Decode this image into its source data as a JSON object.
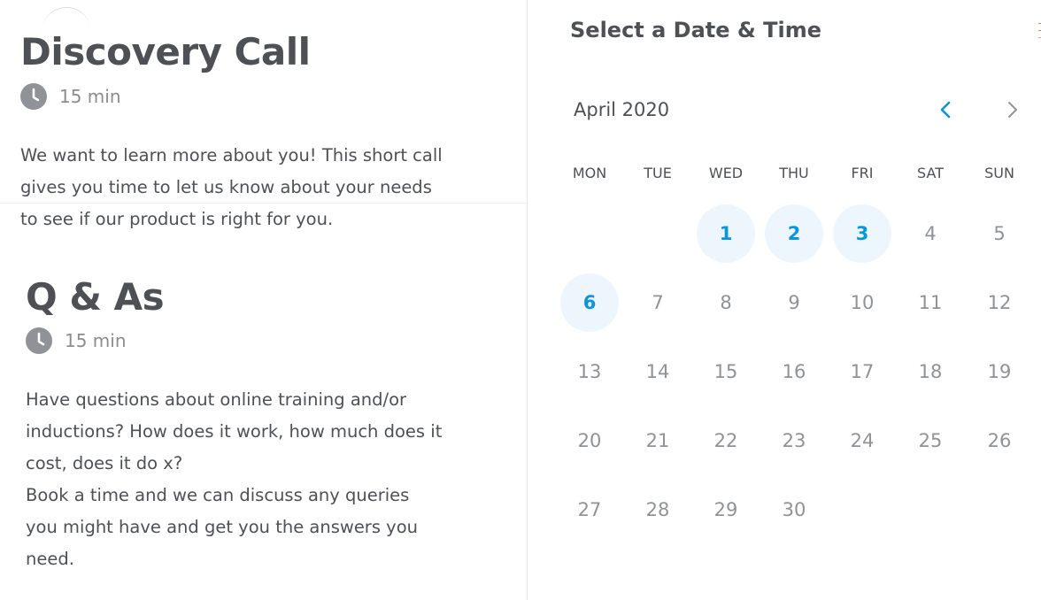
{
  "events": [
    {
      "title": "Discovery Call",
      "duration": "15 min",
      "description_lines": [
        "We want to learn more about you! This short call",
        "gives you time to let us know about your needs",
        "to see if our product is right for you."
      ]
    },
    {
      "title": "Q & As",
      "duration": "15 min",
      "description_lines": [
        "Have questions about online training and/or",
        "inductions? How does it work, how much does it",
        "cost, does it do x?",
        "Book a time and we can discuss any queries",
        "you might have and get you the answers you",
        "need."
      ]
    }
  ],
  "picker": {
    "title": "Select a Date & Time",
    "month_label": "April 2020",
    "prev_icon": "chevron-left-icon",
    "next_icon": "chevron-right-icon",
    "weekdays": [
      "MON",
      "TUE",
      "WED",
      "THU",
      "FRI",
      "SAT",
      "SUN"
    ],
    "first_day_column": 2,
    "days_in_month": 30,
    "available_days": [
      1,
      2,
      3,
      6
    ]
  },
  "colors": {
    "accent": "#0a95dd",
    "available_bg": "#eef6fd",
    "text": "#4d5055",
    "muted": "#8f9296",
    "clock_icon": "#8f9296"
  }
}
